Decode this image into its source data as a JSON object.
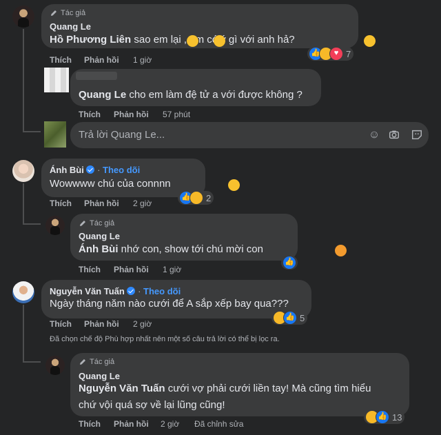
{
  "comments": [
    {
      "author_tag": "Tác giả",
      "author": "Quang Le",
      "mention": "Hồ Phương Liên",
      "text": " sao em lại  , em có ý gì với anh hả? ",
      "actions": {
        "like": "Thích",
        "reply": "Phản hồi",
        "time": "1 giờ"
      },
      "reaction_count": "7",
      "replies": [
        {
          "author": "Quang Le",
          "text": "cho em làm đệ tử a với được không ?",
          "actions": {
            "like": "Thích",
            "reply": "Phản hồi",
            "time": "57 phút"
          }
        }
      ],
      "reply_box_placeholder": "Trả lời Quang Le..."
    },
    {
      "author": "Ánh Bùi",
      "follow": "Theo dõi",
      "text": "Wowwww chú của connnn ",
      "actions": {
        "like": "Thích",
        "reply": "Phản hồi",
        "time": "2 giờ"
      },
      "reaction_count": "2",
      "replies": [
        {
          "author_tag": "Tác giả",
          "author": "Quang Le",
          "mention": "Ánh Bùi",
          "text": " nhớ con, show tới chú mời con ",
          "actions": {
            "like": "Thích",
            "reply": "Phản hồi",
            "time": "1 giờ"
          }
        }
      ]
    },
    {
      "author": "Nguyễn Văn Tuấn",
      "follow": "Theo dõi",
      "text": "Ngày tháng năm nào cưới để A sắp xếp bay qua???",
      "actions": {
        "like": "Thích",
        "reply": "Phản hồi",
        "time": "2 giờ"
      },
      "reaction_count": "5",
      "filter_note": "Đã chọn chế độ Phù hợp nhất nên một số câu trả lời có thể bị lọc ra.",
      "replies": [
        {
          "author_tag": "Tác giả",
          "author": "Quang Le",
          "mention": "Nguyễn Văn Tuấn",
          "text_line1": " cưới vợ phải cưới liền tay! Mà cũng tìm hiểu",
          "text_line2": "chứ vội quá sợ về lại lũng cũng!",
          "actions": {
            "like": "Thích",
            "reply": "Phản hồi",
            "time": "2 giờ",
            "edited": "Đã chỉnh sửa"
          },
          "reaction_count": "13"
        }
      ]
    }
  ],
  "icons": {
    "emoji_tool": "emoji-icon",
    "camera_tool": "camera-icon",
    "gif_tool": "gif-icon",
    "sticker_tool": "sticker-icon"
  },
  "gif_label": "GIF"
}
